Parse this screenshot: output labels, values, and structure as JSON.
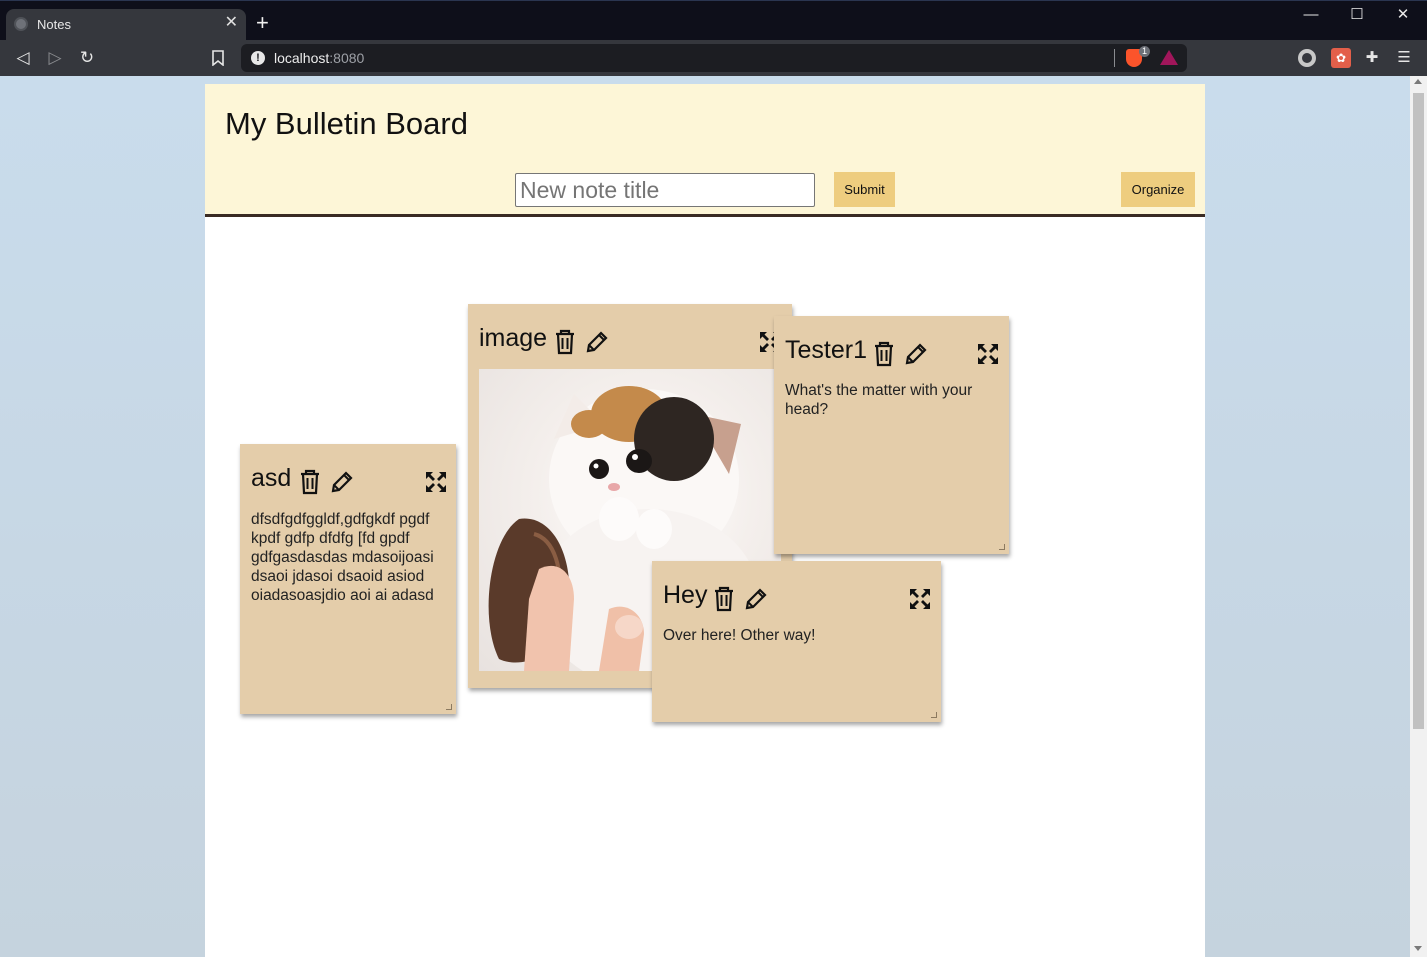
{
  "browser": {
    "tab_title": "Notes",
    "tab_close": "✕",
    "new_tab": "+",
    "url_host": "localhost",
    "url_port": ":8080",
    "shield_count": "1",
    "window_controls": {
      "minimize": "—",
      "maximize": "☐",
      "close": "✕"
    }
  },
  "page": {
    "title": "My Bulletin Board",
    "new_note_placeholder": "New note title",
    "new_note_value": "",
    "submit_label": "Submit",
    "organize_label": "Organize"
  },
  "notes": [
    {
      "title": "asd",
      "body": "dfsdfgdfggldf,gdfgkdf pgdf kpdf gdfp dfdfg [fd gpdf gdfgasdasdas mdasoijoasi dsaoi jdasoi dsaoid asiod oiadasoasjdio aoi ai adasd"
    },
    {
      "title": "image",
      "body": "",
      "image": "kitten photo"
    },
    {
      "title": "Tester1",
      "body": "What's the matter with your head?"
    },
    {
      "title": "Hey",
      "body": "Over here! Other way!"
    }
  ],
  "colors": {
    "header_bg": "#fdf6d7",
    "button_bg": "#eecd7f",
    "note_bg": "#e4cdaa",
    "header_border": "#3a2b24"
  },
  "icons": {
    "delete": "trash-icon",
    "edit": "pencil-icon",
    "expand": "expand-icon"
  }
}
